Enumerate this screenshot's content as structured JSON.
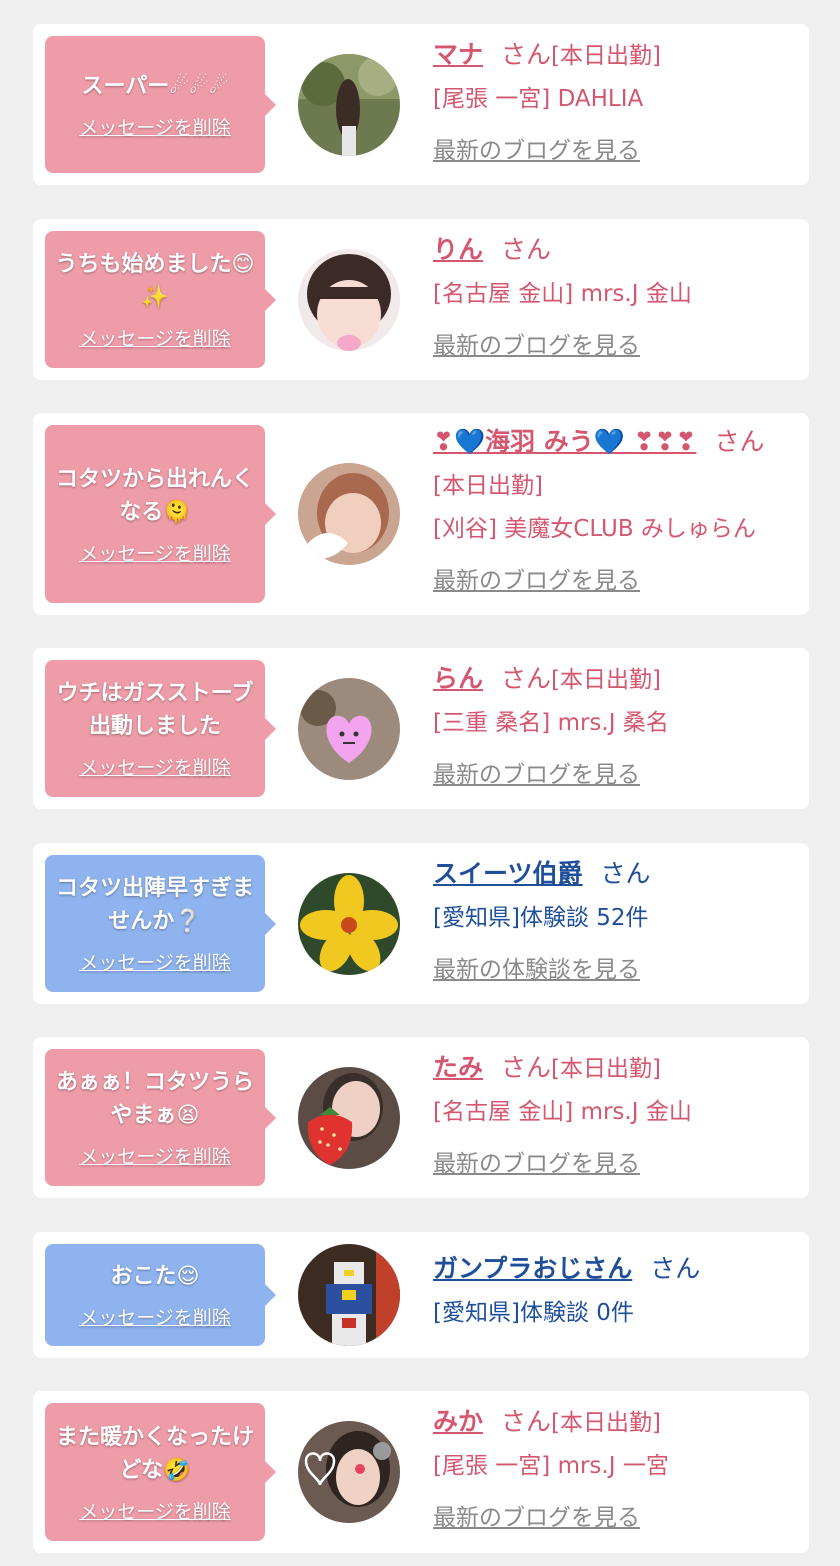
{
  "delete_label": "メッセージを削除",
  "san": "さん",
  "items": [
    {
      "message": "スーパー☄☄☄",
      "name": "マナ",
      "status": "[本日出勤]",
      "shop": "[尾張 一宮] DAHLIA",
      "link": "最新のブログを見る",
      "bubble_color": "#ee9ca8"
    },
    {
      "message": "うちも始めました😊✨",
      "name": "りん",
      "status": "",
      "shop": "[名古屋 金山] mrs.J 金山",
      "link": "最新のブログを見る",
      "bubble_color": "#ee9ca8"
    },
    {
      "message": "コタツから出れんくなる🫠",
      "name": "❣💙海羽 みう💙 ❣❣❣",
      "status": "[本日出勤]",
      "shop": "[刈谷] 美魔女CLUB みしゅらん",
      "link": "最新のブログを見る",
      "bubble_color": "#ee9ca8"
    },
    {
      "message": "ウチはガスストーブ出動しました",
      "name": "らん",
      "status": "[本日出勤]",
      "shop": "[三重 桑名] mrs.J 桑名",
      "link": "最新のブログを見る",
      "bubble_color": "#ee9ca8"
    },
    {
      "message": "コタツ出陣早すぎませんか❔",
      "name": "スイーツ伯爵",
      "status": "",
      "shop": "[愛知県]体験談 52件",
      "link": "最新の体験談を見る",
      "bubble_color": "#8fb3ee"
    },
    {
      "message": "あぁぁ！コタツうらやまぁ😫",
      "name": "たみ",
      "status": "[本日出勤]",
      "shop": "[名古屋 金山] mrs.J 金山",
      "link": "最新のブログを見る",
      "bubble_color": "#ee9ca8"
    },
    {
      "message": "おこた😌",
      "name": "ガンプラおじさん",
      "status": "",
      "shop": "[愛知県]体験談 0件",
      "link": "",
      "bubble_color": "#8fb3ee"
    },
    {
      "message": "また暖かくなったけどな🤣",
      "name": "みか",
      "status": "[本日出勤]",
      "shop": "[尾張 一宮] mrs.J 一宮",
      "link": "最新のブログを見る",
      "bubble_color": "#ee9ca8"
    }
  ]
}
